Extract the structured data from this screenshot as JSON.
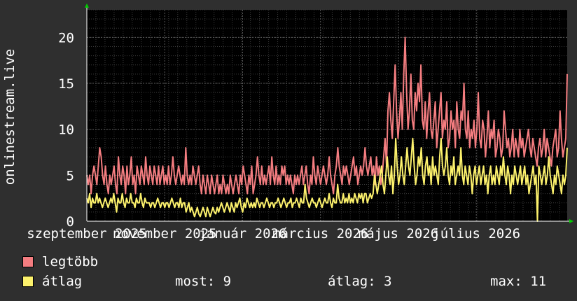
{
  "chart_data": {
    "type": "line",
    "ylabel": "onlinestream.live",
    "ylim": [
      0,
      23
    ],
    "yticks": [
      0,
      5,
      10,
      15,
      20
    ],
    "x_tick_labels": [
      "szeptember 2025",
      "november 2025",
      "január 2026",
      "március 2026",
      "május 2026",
      "július 2026"
    ],
    "x_range_days": [
      0,
      370
    ],
    "x_tick_days": [
      0,
      60,
      120,
      180,
      240,
      300
    ],
    "grid": true,
    "series": [
      {
        "name": "legtöbb",
        "color": "#f47d80",
        "values": [
          5,
          4,
          5,
          3,
          5,
          6,
          5,
          4,
          6,
          8,
          7,
          5,
          4,
          6,
          4,
          3,
          5,
          4,
          5,
          6,
          4,
          3,
          7,
          5,
          4,
          6,
          5,
          3,
          6,
          4,
          5,
          7,
          4,
          5,
          3,
          6,
          5,
          4,
          6,
          5,
          4,
          7,
          5,
          4,
          6,
          5,
          4,
          6,
          5,
          4,
          6,
          4,
          5,
          6,
          4,
          5,
          4,
          6,
          4,
          5,
          7,
          5,
          4,
          5,
          6,
          5,
          4,
          5,
          4,
          8,
          5,
          4,
          5,
          4,
          6,
          5,
          4,
          5,
          6,
          4,
          3,
          5,
          4,
          3,
          5,
          4,
          3,
          5,
          4,
          3,
          4,
          5,
          3,
          4,
          3,
          5,
          4,
          3,
          4,
          3,
          5,
          4,
          3,
          4,
          5,
          4,
          3,
          5,
          4,
          6,
          5,
          4,
          3,
          5,
          4,
          6,
          3,
          4,
          5,
          7,
          5,
          4,
          6,
          4,
          5,
          4,
          5,
          6,
          4,
          7,
          5,
          4,
          6,
          4,
          5,
          4,
          6,
          5,
          6,
          4,
          5,
          4,
          5,
          4,
          3,
          5,
          4,
          5,
          4,
          5,
          6,
          4,
          5,
          6,
          4,
          3,
          5,
          4,
          7,
          5,
          4,
          6,
          5,
          4,
          5,
          6,
          5,
          4,
          5,
          7,
          5,
          4,
          3,
          5,
          6,
          8,
          6,
          5,
          4,
          6,
          5,
          6,
          5,
          4,
          5,
          6,
          7,
          5,
          6,
          4,
          5,
          6,
          5,
          6,
          8,
          6,
          5,
          6,
          7,
          5,
          6,
          4,
          7,
          5,
          6,
          4,
          5,
          7,
          9,
          6,
          12,
          14,
          11,
          9,
          13,
          17,
          12,
          9,
          11,
          14,
          10,
          16,
          20,
          14,
          10,
          12,
          16,
          11,
          10,
          14,
          12,
          15,
          13,
          17,
          11,
          10,
          13,
          9,
          12,
          14,
          10,
          9,
          11,
          13,
          8,
          10,
          12,
          14,
          9,
          11,
          10,
          13,
          8,
          9,
          12,
          10,
          11,
          8,
          13,
          10,
          9,
          12,
          11,
          15,
          10,
          9,
          12,
          8,
          10,
          9,
          11,
          8,
          10,
          14,
          9,
          8,
          11,
          10,
          7,
          9,
          12,
          8,
          10,
          9,
          11,
          7,
          8,
          10,
          9,
          7,
          8,
          12,
          10,
          8,
          9,
          7,
          8,
          10,
          7,
          9,
          8,
          7,
          10,
          8,
          9,
          7,
          8,
          9,
          10,
          8,
          7,
          9,
          8,
          7,
          6,
          8,
          9,
          7,
          8,
          10,
          7,
          9,
          8,
          7,
          6,
          8,
          9,
          10,
          7,
          8,
          12,
          9,
          7,
          8,
          9,
          16
        ]
      },
      {
        "name": "átlag",
        "color": "#fcf16c",
        "values": [
          2.5,
          2,
          3,
          1.5,
          2.5,
          2,
          2,
          3,
          2,
          2.5,
          2,
          1.5,
          2,
          2.5,
          2,
          1.5,
          2,
          2.5,
          2,
          3,
          2,
          1,
          2.5,
          2,
          2,
          3,
          2,
          1.5,
          2.5,
          2,
          2,
          3,
          2,
          2,
          1.5,
          2.5,
          2,
          2,
          3,
          2,
          1.5,
          2.5,
          2,
          2,
          2,
          1.5,
          2,
          2,
          1.5,
          2,
          2.5,
          2,
          1.5,
          2,
          2,
          1.5,
          2,
          2,
          1.5,
          2,
          2.5,
          2,
          1.5,
          2,
          2,
          1.5,
          2.5,
          1.5,
          2,
          2,
          1,
          1.5,
          2,
          1,
          1.5,
          1,
          0.5,
          1,
          1.5,
          0.8,
          0.5,
          1,
          1.5,
          1,
          0.5,
          1.5,
          1,
          0.5,
          1,
          1.5,
          1,
          0.8,
          1.5,
          1,
          1.5,
          2,
          1.5,
          1,
          1.5,
          2,
          1.5,
          1,
          2,
          1.5,
          1,
          2,
          1.5,
          2,
          2.5,
          1.5,
          1,
          2,
          1.5,
          2.5,
          2,
          1.5,
          2,
          1.5,
          2,
          1.5,
          2.5,
          2,
          1.5,
          2,
          2,
          1.5,
          2,
          2.5,
          2,
          1.5,
          2,
          2,
          1.5,
          2,
          2,
          2.5,
          2,
          1.5,
          2,
          2.5,
          2,
          1.5,
          2,
          2,
          2.5,
          1.5,
          2,
          2,
          2.5,
          2,
          1.5,
          2.5,
          2,
          2,
          4,
          2.5,
          2,
          1.5,
          2,
          2.5,
          2,
          2,
          1.5,
          2,
          2.5,
          2,
          1.5,
          2,
          2.5,
          2,
          2,
          3,
          2,
          1.5,
          2.5,
          2,
          2,
          4,
          2.5,
          2,
          2,
          3,
          2,
          2.5,
          2,
          3,
          2,
          2.5,
          2,
          3,
          2.5,
          2,
          3,
          2.5,
          3,
          2,
          3,
          3,
          2,
          2.5,
          3,
          2.5,
          3,
          5,
          4,
          3,
          4,
          5,
          6,
          4,
          3,
          5,
          7,
          5,
          4,
          6,
          3,
          5,
          9,
          6,
          4,
          5,
          7,
          5,
          4,
          6,
          8,
          6,
          5,
          7,
          9,
          6,
          4,
          5,
          7,
          6,
          8,
          5,
          4,
          6,
          7,
          5,
          6,
          4,
          7,
          5,
          6,
          5,
          4,
          7,
          9,
          6,
          5,
          6,
          8,
          5,
          4,
          6,
          5,
          7,
          4,
          5,
          6,
          5,
          8,
          5,
          4,
          6,
          5,
          4,
          6,
          5,
          3,
          5,
          6,
          4,
          5,
          6,
          4,
          5,
          6,
          4,
          5,
          3,
          5,
          6,
          4,
          5,
          4,
          6,
          5,
          4,
          6,
          5,
          7,
          5,
          4,
          6,
          5,
          3,
          5,
          4,
          6,
          5,
          4,
          5,
          6,
          4,
          5,
          6,
          4,
          5,
          3,
          4,
          5,
          6,
          4,
          5,
          0,
          6,
          5,
          4,
          5,
          6,
          4,
          5,
          7,
          5,
          4,
          3,
          5,
          4,
          6,
          5,
          4,
          3,
          5,
          4,
          5,
          8
        ]
      }
    ],
    "stats": {
      "most": "most: 9",
      "atlag": "átlag: 3",
      "max": "max: 11"
    }
  }
}
